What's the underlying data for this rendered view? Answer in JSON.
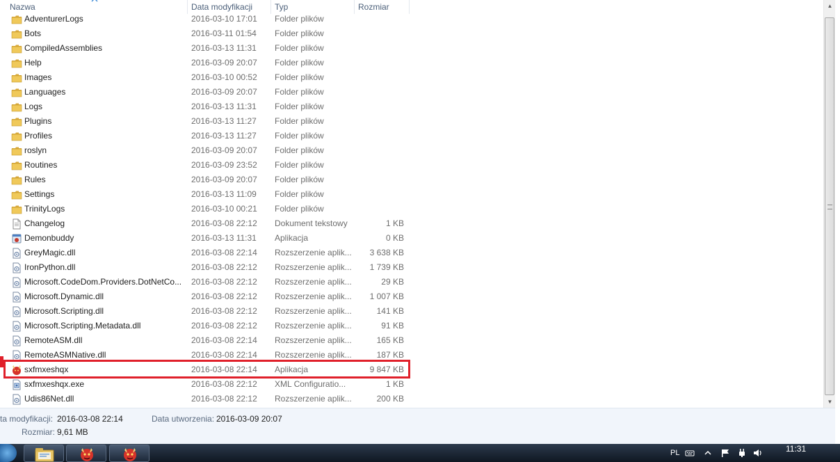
{
  "columns": {
    "name": "Nazwa",
    "date": "Data modyfikacji",
    "type": "Typ",
    "size": "Rozmiar"
  },
  "files": [
    {
      "name": "AdventurerLogs",
      "date": "2016-03-10 17:01",
      "type": "Folder plików",
      "size": "",
      "icon": "folder-icon"
    },
    {
      "name": "Bots",
      "date": "2016-03-11 01:54",
      "type": "Folder plików",
      "size": "",
      "icon": "folder-icon"
    },
    {
      "name": "CompiledAssemblies",
      "date": "2016-03-13 11:31",
      "type": "Folder plików",
      "size": "",
      "icon": "folder-icon"
    },
    {
      "name": "Help",
      "date": "2016-03-09 20:07",
      "type": "Folder plików",
      "size": "",
      "icon": "folder-icon"
    },
    {
      "name": "Images",
      "date": "2016-03-10 00:52",
      "type": "Folder plików",
      "size": "",
      "icon": "folder-icon"
    },
    {
      "name": "Languages",
      "date": "2016-03-09 20:07",
      "type": "Folder plików",
      "size": "",
      "icon": "folder-icon"
    },
    {
      "name": "Logs",
      "date": "2016-03-13 11:31",
      "type": "Folder plików",
      "size": "",
      "icon": "folder-icon"
    },
    {
      "name": "Plugins",
      "date": "2016-03-13 11:27",
      "type": "Folder plików",
      "size": "",
      "icon": "folder-icon"
    },
    {
      "name": "Profiles",
      "date": "2016-03-13 11:27",
      "type": "Folder plików",
      "size": "",
      "icon": "folder-icon"
    },
    {
      "name": "roslyn",
      "date": "2016-03-09 20:07",
      "type": "Folder plików",
      "size": "",
      "icon": "folder-icon"
    },
    {
      "name": "Routines",
      "date": "2016-03-09 23:52",
      "type": "Folder plików",
      "size": "",
      "icon": "folder-icon"
    },
    {
      "name": "Rules",
      "date": "2016-03-09 20:07",
      "type": "Folder plików",
      "size": "",
      "icon": "folder-icon"
    },
    {
      "name": "Settings",
      "date": "2016-03-13 11:09",
      "type": "Folder plików",
      "size": "",
      "icon": "folder-icon"
    },
    {
      "name": "TrinityLogs",
      "date": "2016-03-10 00:21",
      "type": "Folder plików",
      "size": "",
      "icon": "folder-icon"
    },
    {
      "name": "Changelog",
      "date": "2016-03-08 22:12",
      "type": "Dokument tekstowy",
      "size": "1 KB",
      "icon": "text-document-icon"
    },
    {
      "name": "Demonbuddy",
      "date": "2016-03-13 11:31",
      "type": "Aplikacja",
      "size": "0 KB",
      "icon": "application-icon"
    },
    {
      "name": "GreyMagic.dll",
      "date": "2016-03-08 22:14",
      "type": "Rozszerzenie aplik...",
      "size": "3 638 KB",
      "icon": "dll-icon"
    },
    {
      "name": "IronPython.dll",
      "date": "2016-03-08 22:12",
      "type": "Rozszerzenie aplik...",
      "size": "1 739 KB",
      "icon": "dll-icon"
    },
    {
      "name": "Microsoft.CodeDom.Providers.DotNetCo...",
      "date": "2016-03-08 22:12",
      "type": "Rozszerzenie aplik...",
      "size": "29 KB",
      "icon": "dll-icon"
    },
    {
      "name": "Microsoft.Dynamic.dll",
      "date": "2016-03-08 22:12",
      "type": "Rozszerzenie aplik...",
      "size": "1 007 KB",
      "icon": "dll-icon"
    },
    {
      "name": "Microsoft.Scripting.dll",
      "date": "2016-03-08 22:12",
      "type": "Rozszerzenie aplik...",
      "size": "141 KB",
      "icon": "dll-icon"
    },
    {
      "name": "Microsoft.Scripting.Metadata.dll",
      "date": "2016-03-08 22:12",
      "type": "Rozszerzenie aplik...",
      "size": "91 KB",
      "icon": "dll-icon"
    },
    {
      "name": "RemoteASM.dll",
      "date": "2016-03-08 22:14",
      "type": "Rozszerzenie aplik...",
      "size": "165 KB",
      "icon": "dll-icon"
    },
    {
      "name": "RemoteASMNative.dll",
      "date": "2016-03-08 22:14",
      "type": "Rozszerzenie aplik...",
      "size": "187 KB",
      "icon": "dll-icon"
    },
    {
      "name": "sxfmxeshqx",
      "date": "2016-03-08 22:14",
      "type": "Aplikacja",
      "size": "9 847 KB",
      "icon": "demon-app-icon"
    },
    {
      "name": "sxfmxeshqx.exe",
      "date": "2016-03-08 22:12",
      "type": "XML Configuratio...",
      "size": "1 KB",
      "icon": "xml-config-icon"
    },
    {
      "name": "Udis86Net.dll",
      "date": "2016-03-08 22:12",
      "type": "Rozszerzenie aplik...",
      "size": "200 KB",
      "icon": "dll-icon"
    }
  ],
  "details": {
    "modified_label": "ta modyfikacji:",
    "modified_value": "2016-03-08 22:14",
    "created_label": "Data utworzenia:",
    "created_value": "2016-03-09 20:07",
    "size_label": "Rozmiar:",
    "size_value": "9,61 MB"
  },
  "tray": {
    "language": "PL",
    "time": "11:31"
  },
  "colors": {
    "highlight": "#e0202a",
    "folder": "#e8c050"
  }
}
